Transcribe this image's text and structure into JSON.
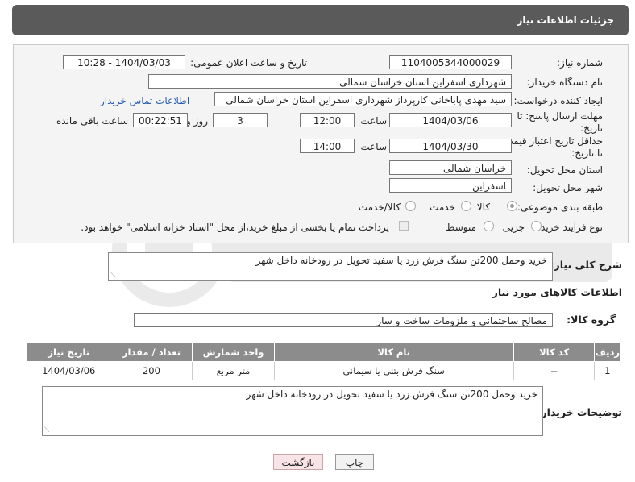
{
  "title": "جزئیات اطلاعات نیاز",
  "fields": {
    "need_number_label": "شماره نیاز:",
    "need_number": "1104005344000029",
    "announce_label": "تاریخ و ساعت اعلان عمومی:",
    "announce_value": "1404/03/03 - 10:28",
    "buyer_org_label": "نام دستگاه خریدار:",
    "buyer_org": "شهرداری اسفراین استان خراسان شمالی",
    "creator_label": "ایجاد کننده درخواست:",
    "creator": "سید مهدی  پاباخانی کارپرداز   شهرداری اسفراین استان خراسان شمالی",
    "contact_link": "اطلاعات تماس خریدار",
    "reply_deadline_label_1": "مهلت ارسال پاسخ: تا",
    "reply_deadline_label_2": "تاریخ:",
    "reply_date": "1404/03/06",
    "time_label": "ساعت",
    "reply_time": "12:00",
    "days_value": "3",
    "days_label": "روز و",
    "remaining_time": "00:22:51",
    "remaining_label": "ساعت باقی مانده",
    "price_deadline_label_1": "حداقل تاریخ اعتبار قیمت:",
    "price_deadline_label_2": "تا تاریخ:",
    "price_date": "1404/03/30",
    "price_time": "14:00",
    "province_label": "استان محل تحویل:",
    "province": "خراسان شمالی",
    "city_label": "شهر محل تحویل:",
    "city": "اسفراین",
    "category_label": "طبقه بندی موضوعی:",
    "category_options": [
      "کالا",
      "خدمت",
      "کالا/خدمت"
    ],
    "process_label": "نوع فرآیند خرید :",
    "process_options": [
      "جزیی",
      "متوسط"
    ],
    "payment_note": "پرداخت تمام یا بخشی از مبلغ خرید،از محل \"اسناد خزانه اسلامی\" خواهد بود."
  },
  "summary": {
    "label": "شرح کلی نیاز:",
    "text": "خرید وحمل 200تن سنگ فرش زرد یا سفید تحویل در رودخانه داخل شهر"
  },
  "goods_section": "اطلاعات کالاهای مورد نیاز",
  "group": {
    "label": "گروه کالا:",
    "value": "مصالح ساختمانی و ملزومات ساخت و ساز"
  },
  "table": {
    "headers": [
      "ردیف",
      "کد کالا",
      "نام کالا",
      "واحد شمارش",
      "تعداد / مقدار",
      "تاریخ نیاز"
    ],
    "rows": [
      [
        "1",
        "--",
        "سنگ فرش بتنی یا سیمانی",
        "متر مربع",
        "200",
        "1404/03/06"
      ]
    ]
  },
  "buyer_notes": {
    "label": "توضیحات خریدار:",
    "text": "خرید وحمل 200تن سنگ فرش زرد یا سفید تحویل در رودخانه داخل شهر"
  },
  "buttons": {
    "print": "چاپ",
    "back": "بازگشت"
  },
  "colors": {
    "title_bg": "#5a5a5a",
    "table_header": "#8c8c8c",
    "link": "#2a5db0",
    "back_button": "#f8e4e6"
  }
}
